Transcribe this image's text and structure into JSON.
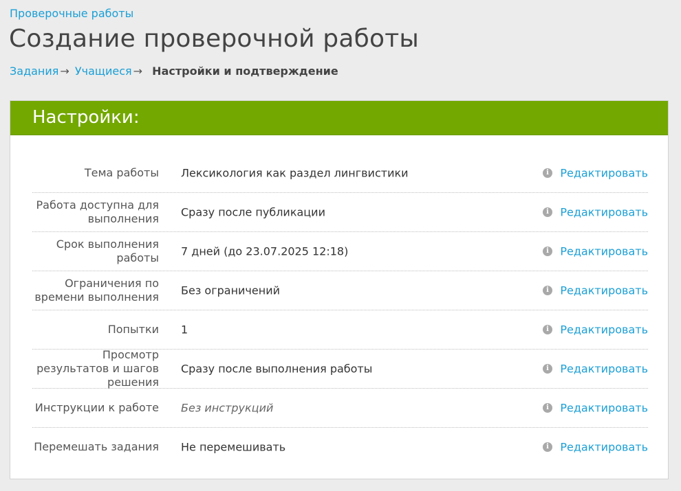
{
  "breadcrumb": {
    "parent": "Проверочные работы"
  },
  "page": {
    "title": "Создание проверочной работы"
  },
  "steps": {
    "step1": "Задания",
    "step2": "Учащиеся",
    "arrow": "→",
    "current": "Настройки и подтверждение"
  },
  "panel": {
    "title": "Настройки:"
  },
  "edit_label": "Редактировать",
  "info_glyph": "i",
  "settings": [
    {
      "label": "Тема работы",
      "value": "Лексикология как раздел лингвистики"
    },
    {
      "label": "Работа доступна для выполнения",
      "value": "Сразу после публикации"
    },
    {
      "label": "Срок выполнения работы",
      "value": "7 дней (до 23.07.2025 12:18)"
    },
    {
      "label": "Ограничения по времени выполнения",
      "value": "Без ограничений"
    },
    {
      "label": "Попытки",
      "value": "1"
    },
    {
      "label": "Просмотр результатов и шагов решения",
      "value": "Сразу после выполнения работы"
    },
    {
      "label": "Инструкции к работе",
      "value": "Без инструкций"
    },
    {
      "label": "Перемешать задания",
      "value": "Не перемешивать"
    }
  ]
}
